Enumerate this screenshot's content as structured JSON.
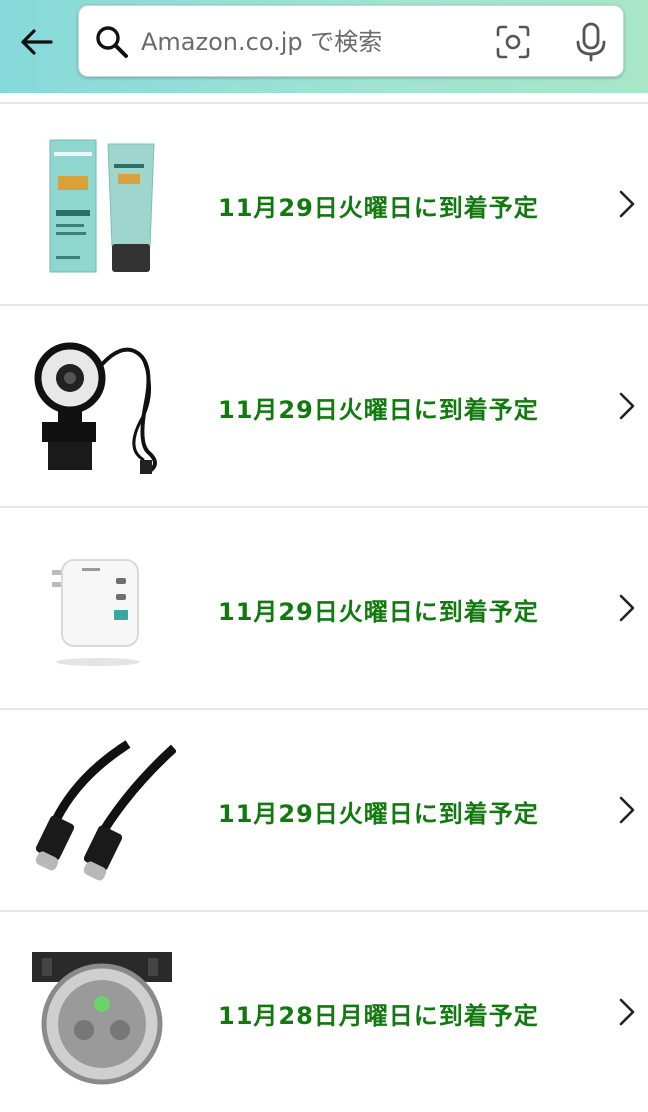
{
  "header": {
    "back_icon": "arrow-left-icon",
    "search": {
      "placeholder": "Amazon.co.jp で検索",
      "value": ""
    },
    "camera_icon": "camera-scan-icon",
    "mic_icon": "microphone-icon",
    "background_colors": [
      "#86d9db",
      "#a9e6c8"
    ]
  },
  "accent_color": "#12790f",
  "items": [
    {
      "delivery": "11月29日火曜日に到着予定",
      "thumbnail": "skincare-cream-product-image",
      "chevron": "chevron-right-icon"
    },
    {
      "delivery": "11月29日火曜日に到着予定",
      "thumbnail": "webcam-ring-light-product-image",
      "chevron": "chevron-right-icon"
    },
    {
      "delivery": "11月29日火曜日に到着予定",
      "thumbnail": "usb-charger-product-image",
      "chevron": "chevron-right-icon"
    },
    {
      "delivery": "11月29日火曜日に到着予定",
      "thumbnail": "usb-c-cable-product-image",
      "chevron": "chevron-right-icon"
    },
    {
      "delivery": "11月28日月曜日に到着予定",
      "thumbnail": "smartwatch-product-image",
      "chevron": "chevron-right-icon"
    }
  ]
}
